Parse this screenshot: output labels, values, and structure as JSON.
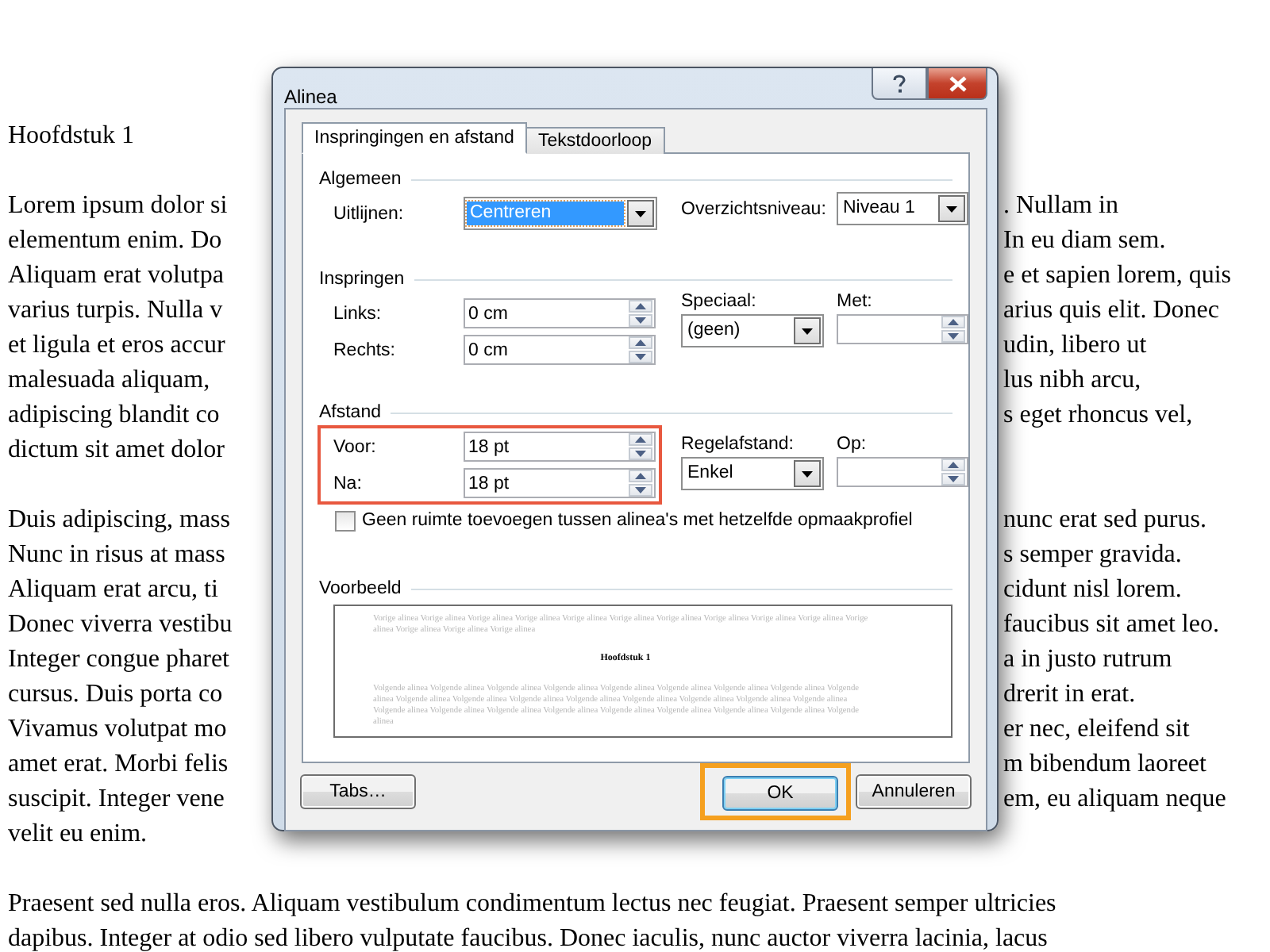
{
  "document": {
    "paragraphs": [
      {
        "lines": [
          {
            "left": "Hoofdstuk 1"
          }
        ]
      },
      {
        "lines": [
          {
            "left": "Lorem ipsum dolor si",
            "right": ". Nullam in"
          },
          {
            "left": "elementum enim. Do",
            "right": "In eu diam sem."
          },
          {
            "left": "Aliquam erat volutpa",
            "right": "e et sapien lorem, quis"
          },
          {
            "left": "varius turpis. Nulla v",
            "right": "arius quis elit. Donec"
          },
          {
            "left": "et ligula et eros accur",
            "right": "udin, libero ut"
          },
          {
            "left": "malesuada aliquam,",
            "right": "lus nibh arcu,"
          },
          {
            "left": "adipiscing blandit co",
            "right": "s eget rhoncus vel,"
          },
          {
            "left": "dictum sit amet dolor"
          }
        ]
      },
      {
        "lines": [
          {
            "left": "Duis adipiscing, mass",
            "right": "nunc erat sed purus."
          },
          {
            "left": "Nunc in risus at mass",
            "right": "s semper gravida."
          },
          {
            "left": "Aliquam erat arcu, ti",
            "right": "cidunt nisl lorem."
          },
          {
            "left": "Donec viverra vestibu",
            "right": "faucibus sit amet leo."
          },
          {
            "left": "Integer congue pharet",
            "right": "a in justo rutrum"
          },
          {
            "left": "cursus. Duis porta co",
            "right": "drerit in erat."
          },
          {
            "left": "Vivamus volutpat mo",
            "right": "er nec, eleifend sit"
          },
          {
            "left": "amet erat. Morbi felis",
            "right": "m bibendum laoreet"
          },
          {
            "left": "suscipit. Integer vene",
            "right": "em, eu aliquam neque"
          },
          {
            "left": "velit eu enim."
          }
        ]
      },
      {
        "lines": [
          {
            "left": "Praesent sed nulla eros. Aliquam vestibulum condimentum lectus nec feugiat. Praesent semper ultricies"
          },
          {
            "left": "dapibus. Integer at odio sed libero vulputate faucibus. Donec iaculis, nunc auctor viverra lacinia, lacus"
          }
        ]
      }
    ]
  },
  "dialog": {
    "title": "Alinea",
    "tabs": [
      {
        "label": "Inspringingen en afstand",
        "selected": true
      },
      {
        "label": "Tekstdoorloop",
        "selected": false
      }
    ],
    "general": {
      "title": "Algemeen",
      "alignment": {
        "label": "Uitlijnen:",
        "value": "Centreren",
        "focused": true
      },
      "outline_level": {
        "label": "Overzichtsniveau:",
        "value": "Niveau 1"
      }
    },
    "indentation": {
      "title": "Inspringen",
      "left": {
        "label": "Links:",
        "value": "0 cm"
      },
      "right": {
        "label": "Rechts:",
        "value": "0 cm"
      },
      "special": {
        "label": "Speciaal:",
        "value": "(geen)"
      },
      "by": {
        "label": "Met:"
      }
    },
    "spacing": {
      "title": "Afstand",
      "highlighted": true,
      "before": {
        "label": "Voor:",
        "value": "18 pt"
      },
      "after": {
        "label": "Na:",
        "value": "18 pt"
      },
      "line_spacing": {
        "label": "Regelafstand:",
        "value": "Enkel"
      },
      "at": {
        "label": "Op:"
      }
    },
    "no_space_checkbox": {
      "label": "Geen ruimte toevoegen tussen alinea's met hetzelfde opmaakprofiel",
      "checked": false
    },
    "preview": {
      "title": "Voorbeeld",
      "previous_text": "Vorige alinea Vorige alinea Vorige alinea Vorige alinea Vorige alinea Vorige alinea Vorige alinea Vorige alinea Vorige alinea Vorige alinea Vorige alinea Vorige alinea Vorige alinea Vorige alinea",
      "heading": "Hoofdstuk 1",
      "next_text": "Volgende alinea Volgende alinea Volgende alinea Volgende alinea Volgende alinea Volgende alinea Volgende alinea Volgende alinea Volgende alinea Volgende alinea Volgende alinea Volgende alinea Volgende alinea Volgende alinea Volgende alinea Volgende alinea Volgende alinea Volgende alinea Volgende alinea Volgende alinea Volgende alinea Volgende alinea Volgende alinea Volgende alinea Volgende alinea Volgende alinea"
    },
    "buttons": [
      {
        "label": "Tabs…",
        "kind": "normal"
      },
      {
        "label": "OK",
        "kind": "default",
        "highlighted": true
      },
      {
        "label": "Annuleren",
        "kind": "normal"
      }
    ]
  }
}
